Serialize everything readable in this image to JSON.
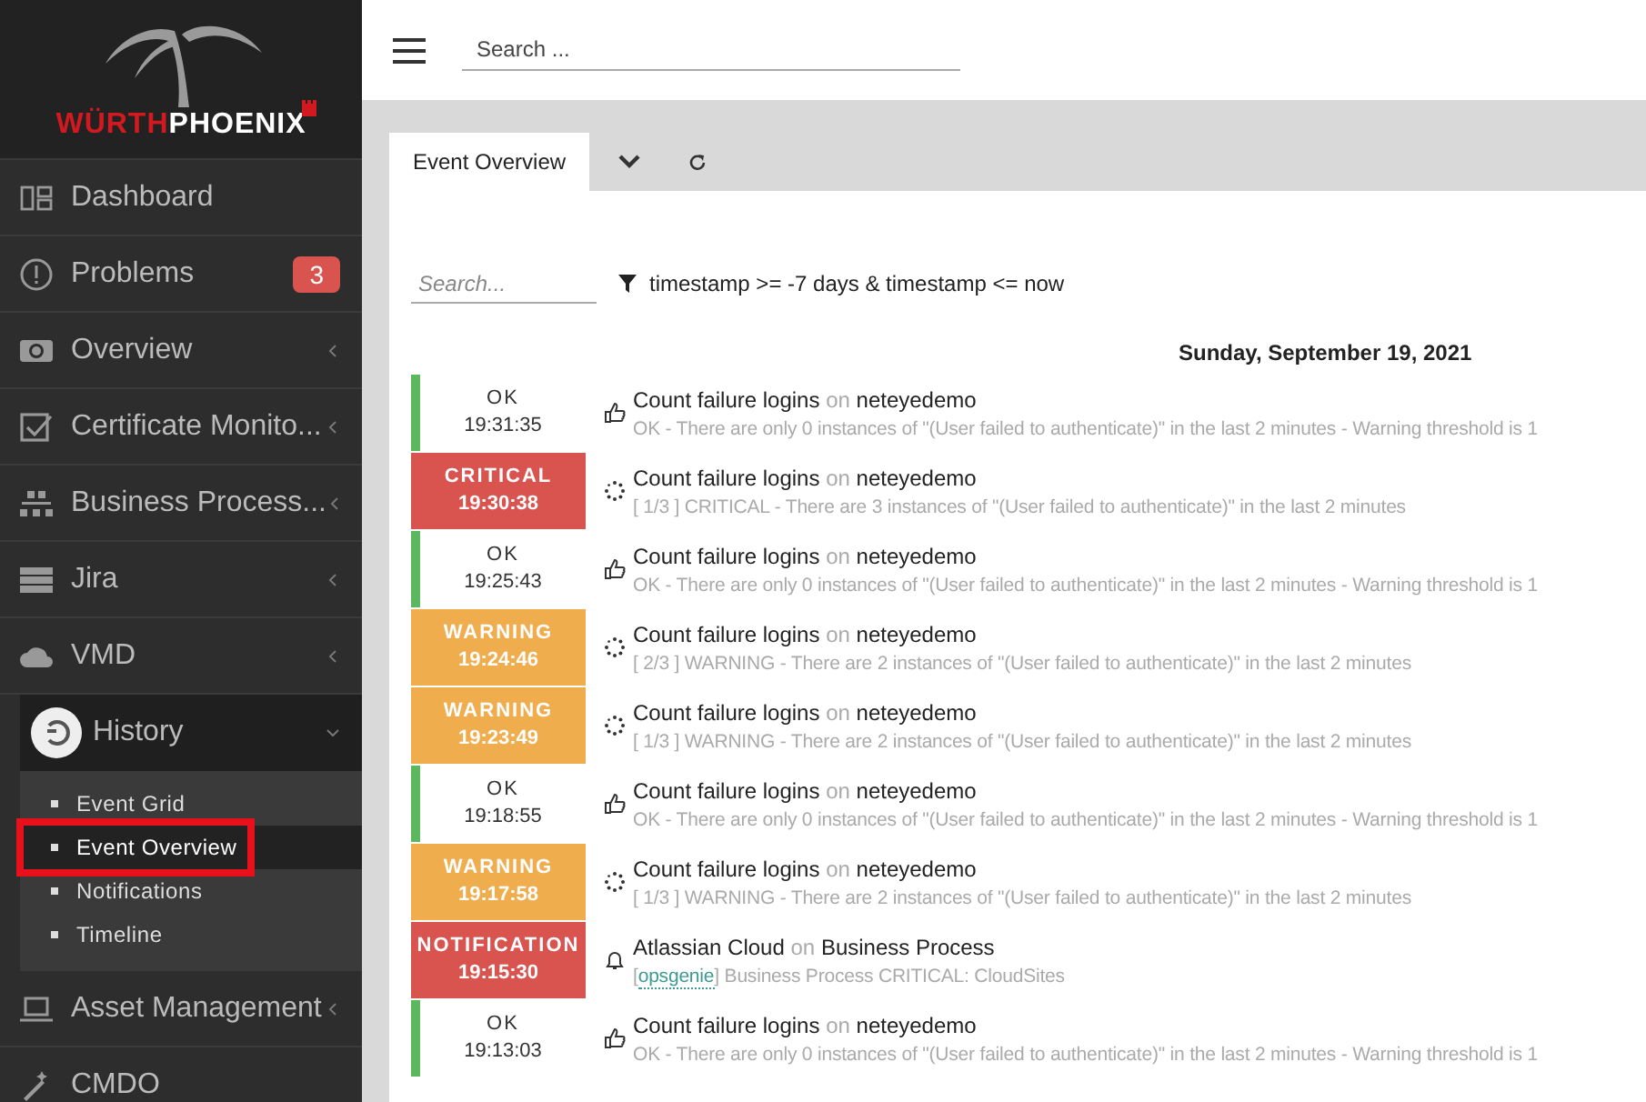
{
  "logo": {
    "part_1": "WÜRTH",
    "part_2": "PHOENIX"
  },
  "sidebar": {
    "items": [
      {
        "label": "Dashboard",
        "chevron": false,
        "expanded": false
      },
      {
        "label": "Problems",
        "badge": "3",
        "chevron": false,
        "expanded": false
      },
      {
        "label": "Overview",
        "chevron": true,
        "expanded": false
      },
      {
        "label": "Certificate Monito...",
        "chevron": true,
        "expanded": false
      },
      {
        "label": "Business Process...",
        "chevron": true,
        "expanded": false
      },
      {
        "label": "Jira",
        "chevron": true,
        "expanded": false
      },
      {
        "label": "VMD",
        "chevron": true,
        "expanded": false
      },
      {
        "label": "History",
        "chevron": true,
        "expanded": true,
        "children": [
          {
            "label": "Event Grid",
            "selected": false,
            "highlighted": false
          },
          {
            "label": "Event Overview",
            "selected": true,
            "highlighted": true
          },
          {
            "label": "Notifications",
            "selected": false,
            "highlighted": false
          },
          {
            "label": "Timeline",
            "selected": false,
            "highlighted": false
          }
        ]
      },
      {
        "label": "Asset Management",
        "chevron": true,
        "expanded": false
      },
      {
        "label": "CMDO",
        "chevron": false,
        "expanded": false
      }
    ]
  },
  "topbar": {
    "search": {
      "placeholder": "Search ..."
    }
  },
  "tabs": [
    {
      "label": "Event Overview",
      "selected": true
    }
  ],
  "panel": {
    "search": {
      "placeholder": "Search..."
    },
    "filter": "timestamp >= -7 days & timestamp <= now",
    "date": "Sunday, September 19, 2021",
    "events": [
      {
        "kind": "ok",
        "status": "OK",
        "time": "19:31:35",
        "name": "Count failure logins",
        "connector": "on",
        "host": "neteyedemo",
        "message": [
          {
            "kind": "plain",
            "text": "OK - There are only 0 instances of \"(User failed to authenticate)\" in the last 2 minutes - Warning threshold is 1"
          }
        ]
      },
      {
        "kind": "critical",
        "status": "CRITICAL",
        "time": "19:30:38",
        "name": "Count failure logins",
        "connector": "on",
        "host": "neteyedemo",
        "message": [
          {
            "kind": "plain",
            "text": "[ 1/3 ] CRITICAL - There are 3 instances of \"(User failed to authenticate)\" in the last 2 minutes"
          }
        ]
      },
      {
        "kind": "ok",
        "status": "OK",
        "time": "19:25:43",
        "name": "Count failure logins",
        "connector": "on",
        "host": "neteyedemo",
        "message": [
          {
            "kind": "plain",
            "text": "OK - There are only 0 instances of \"(User failed to authenticate)\" in the last 2 minutes - Warning threshold is 1"
          }
        ]
      },
      {
        "kind": "warning",
        "status": "WARNING",
        "time": "19:24:46",
        "name": "Count failure logins",
        "connector": "on",
        "host": "neteyedemo",
        "message": [
          {
            "kind": "plain",
            "text": "[ 2/3 ] WARNING - There are 2 instances of \"(User failed to authenticate)\" in the last 2 minutes"
          }
        ]
      },
      {
        "kind": "warning",
        "status": "WARNING",
        "time": "19:23:49",
        "name": "Count failure logins",
        "connector": "on",
        "host": "neteyedemo",
        "message": [
          {
            "kind": "plain",
            "text": "[ 1/3 ] WARNING - There are 2 instances of \"(User failed to authenticate)\" in the last 2 minutes"
          }
        ]
      },
      {
        "kind": "ok",
        "status": "OK",
        "time": "19:18:55",
        "name": "Count failure logins",
        "connector": "on",
        "host": "neteyedemo",
        "message": [
          {
            "kind": "plain",
            "text": "OK - There are only 0 instances of \"(User failed to authenticate)\" in the last 2 minutes - Warning threshold is 1"
          }
        ]
      },
      {
        "kind": "warning",
        "status": "WARNING",
        "time": "19:17:58",
        "name": "Count failure logins",
        "connector": "on",
        "host": "neteyedemo",
        "message": [
          {
            "kind": "plain",
            "text": "[ 1/3 ] WARNING - There are 2 instances of \"(User failed to authenticate)\" in the last 2 minutes"
          }
        ]
      },
      {
        "kind": "notification",
        "status": "NOTIFICATION",
        "time": "19:15:30",
        "name": "Atlassian Cloud",
        "connector": "on",
        "host": "Business Process",
        "message": [
          {
            "kind": "plain",
            "text": "["
          },
          {
            "kind": "link",
            "text": "opsgenie"
          },
          {
            "kind": "plain",
            "text": "] Business Process CRITICAL: CloudSites"
          }
        ]
      },
      {
        "kind": "ok",
        "status": "OK",
        "time": "19:13:03",
        "name": "Count failure logins",
        "connector": "on",
        "host": "neteyedemo",
        "message": [
          {
            "kind": "plain",
            "text": "OK - There are only 0 instances of \"(User failed to authenticate)\" in the last 2 minutes - Warning threshold is 1"
          }
        ]
      }
    ]
  }
}
